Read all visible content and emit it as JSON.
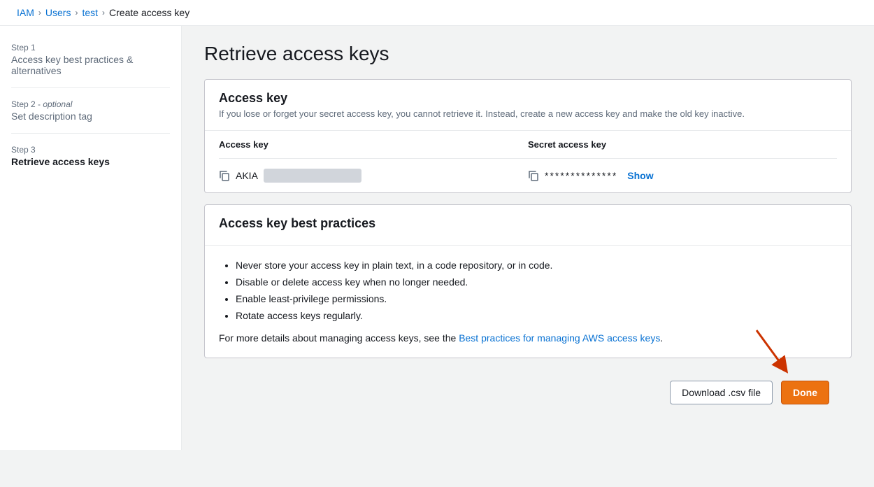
{
  "breadcrumb": {
    "items": [
      {
        "label": "IAM",
        "href": "#"
      },
      {
        "label": "Users",
        "href": "#"
      },
      {
        "label": "test",
        "href": "#"
      },
      {
        "label": "Create access key",
        "current": true
      }
    ],
    "separators": [
      ">",
      ">",
      ">"
    ]
  },
  "sidebar": {
    "steps": [
      {
        "id": "step1",
        "label": "Step 1",
        "title": "Access key best practices & alternatives",
        "optional": false,
        "active": false
      },
      {
        "id": "step2",
        "label": "Step 2 -",
        "optional_label": "optional",
        "title": "Set description tag",
        "optional": true,
        "active": false
      },
      {
        "id": "step3",
        "label": "Step 3",
        "title": "Retrieve access keys",
        "optional": false,
        "active": true
      }
    ]
  },
  "main": {
    "page_title": "Retrieve access keys",
    "access_key_card": {
      "title": "Access key",
      "subtitle": "If you lose or forget your secret access key, you cannot retrieve it. Instead, create a new access key and make the old key inactive.",
      "table": {
        "columns": [
          "Access key",
          "Secret access key"
        ],
        "row": {
          "access_key_prefix": "AKIA",
          "secret_key_masked": "**************",
          "show_label": "Show"
        }
      }
    },
    "best_practices_card": {
      "title": "Access key best practices",
      "bullets": [
        "Never store your access key in plain text, in a code repository, or in code.",
        "Disable or delete access key when no longer needed.",
        "Enable least-privilege permissions.",
        "Rotate access keys regularly."
      ],
      "footer_text": "For more details about managing access keys, see the ",
      "footer_link_text": "Best practices for managing AWS access keys",
      "footer_suffix": "."
    }
  },
  "actions": {
    "download_csv_label": "Download .csv file",
    "done_label": "Done"
  },
  "colors": {
    "primary_orange": "#ec7211",
    "link_blue": "#0972d3",
    "arrow_red": "#cc3300"
  }
}
